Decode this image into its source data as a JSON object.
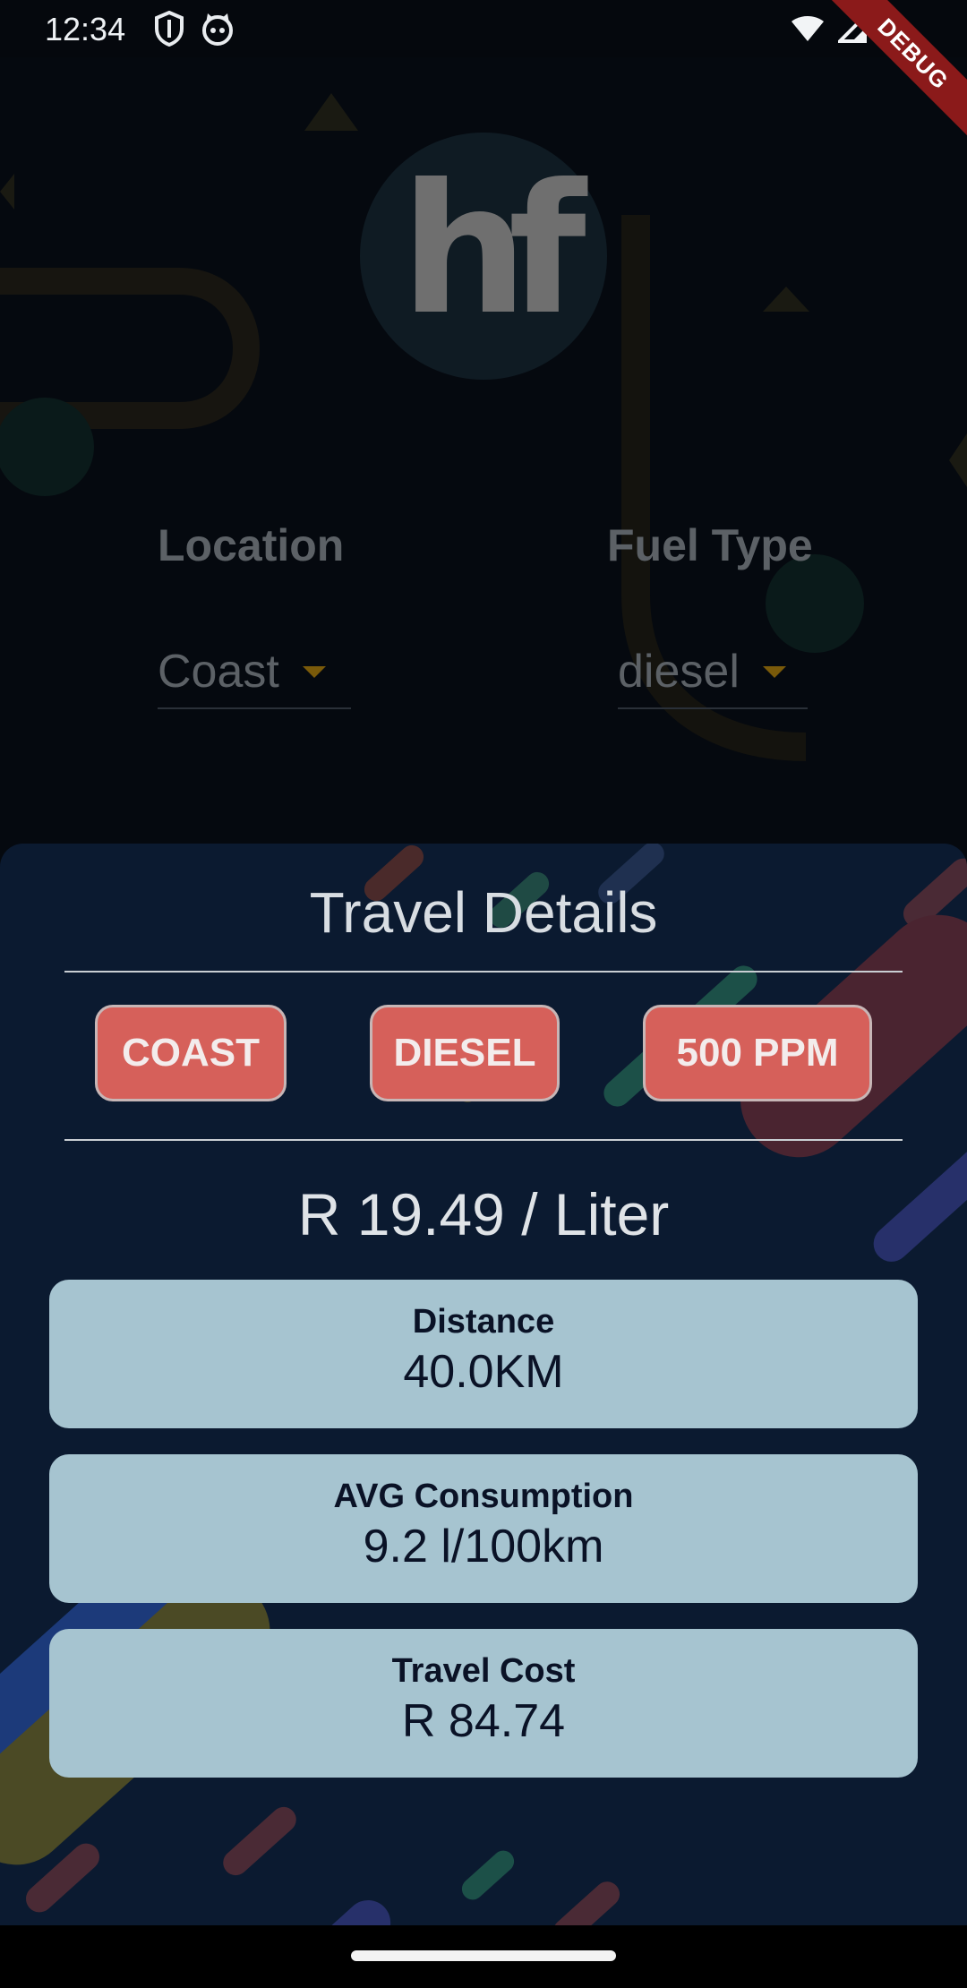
{
  "status_bar": {
    "time": "12:34",
    "icons": [
      "shield-icon",
      "cat-icon",
      "wifi-icon",
      "signal-icon",
      "battery-icon"
    ]
  },
  "debug_banner": "DEBUG",
  "logo": {
    "text": "hf"
  },
  "location": {
    "label": "Location",
    "value": "Coast"
  },
  "fuel_type": {
    "label": "Fuel Type",
    "value": "diesel"
  },
  "travel_details": {
    "title": "Travel Details",
    "tags": [
      "COAST",
      "DIESEL",
      "500 PPM"
    ],
    "price": "R 19.49 / Liter",
    "cards": [
      {
        "label": "Distance",
        "value": "40.0KM"
      },
      {
        "label": "AVG Consumption",
        "value": "9.2 l/100km"
      },
      {
        "label": "Travel Cost",
        "value": "R 84.74"
      }
    ]
  },
  "colors": {
    "tag_bg": "#d6605a",
    "card_bg": "#a6c4d0",
    "panel_bg": "#0b1a30",
    "accent_arrow": "#7a5a0a"
  }
}
